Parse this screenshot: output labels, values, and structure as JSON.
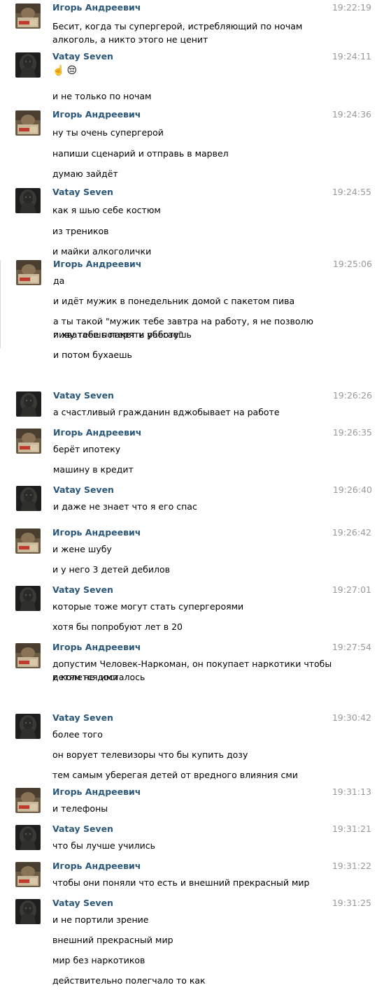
{
  "authors": {
    "igor": "Игорь Андреевич",
    "vatay": "Vatay Seven"
  },
  "messages": [
    {
      "author": "Игорь Андреевич",
      "avatar": "igor",
      "time": "19:22:19",
      "lines": [
        "Бесит, когда ты супергерой, истребляющий по ночам алкоголь, а никто этого не ценит"
      ]
    },
    {
      "author": "Vatay Seven",
      "avatar": "vatay",
      "time": "19:24:11",
      "emoji": [
        "☝️",
        "😔"
      ],
      "lines": [
        "и не только по ночам"
      ]
    },
    {
      "author": "Игорь Андреевич",
      "avatar": "igor",
      "time": "19:24:36",
      "lines": [
        "ну ты очень супергерой",
        "напиши сценарий и отправь в марвел",
        "думаю зайдёт"
      ]
    },
    {
      "author": "Vatay Seven",
      "avatar": "vatay",
      "time": "19:24:55",
      "lines": [
        "как я шью себе костюм",
        "из треников",
        "и майки алкоголички"
      ]
    },
    {
      "author": "Игорь Андреевич",
      "avatar": "igor",
      "time": "19:25:06",
      "lines": [
        "да",
        "и идёт мужик в понедельник домой с пакетом пива",
        "а ты такой \"мужик тебе завтра на работу, я не позволю пиву тебе потерять работу\"",
        "и хватаешь пакет и убегаешь",
        "и потом бухаешь"
      ]
    },
    {
      "author": "Vatay Seven",
      "avatar": "vatay",
      "time": "19:26:26",
      "lines": [
        "а счастливый гражданин вджобывает на работе"
      ]
    },
    {
      "author": "Игорь Андреевич",
      "avatar": "igor",
      "time": "19:26:35",
      "lines": [
        "берёт ипотеку",
        "машину в кредит"
      ]
    },
    {
      "author": "Vatay Seven",
      "avatar": "vatay",
      "time": "19:26:40",
      "lines": [
        "и даже не знает что я его спас"
      ]
    },
    {
      "author": "Игорь Андреевич",
      "avatar": "igor",
      "time": "19:26:42",
      "lines": [
        "и жене шубу",
        "и у него 3 детей дебилов"
      ]
    },
    {
      "author": "Vatay Seven",
      "avatar": "vatay",
      "time": "19:27:01",
      "lines": [
        "которые тоже могут стать супергероями",
        "хотя бы попробуют лет в 20"
      ]
    },
    {
      "author": "Игорь Андреевич",
      "avatar": "igor",
      "time": "19:27:54",
      "lines": [
        "допустим Человек-Наркоман, он покупает наркотики чтобы детям не досталось",
        "и колется ими"
      ]
    },
    {
      "author": "Vatay Seven",
      "avatar": "vatay",
      "time": "19:30:42",
      "lines": [
        "более того",
        "он ворует телевизоры что бы купить дозу",
        "тем самым уберегая детей от вредного влияния сми"
      ]
    },
    {
      "author": "Игорь Андреевич",
      "avatar": "igor",
      "time": "19:31:13",
      "lines": [
        "и телефоны"
      ]
    },
    {
      "author": "Vatay Seven",
      "avatar": "vatay",
      "time": "19:31:21",
      "lines": [
        "что бы лучше учились"
      ]
    },
    {
      "author": "Игорь Андреевич",
      "avatar": "igor",
      "time": "19:31:22",
      "lines": [
        "чтобы они поняли что есть и внешний прекрасный мир"
      ]
    },
    {
      "author": "Vatay Seven",
      "avatar": "vatay",
      "time": "19:31:25",
      "lines": [
        "и не портили зрение",
        "внешний прекрасный мир",
        "мир без наркотиков",
        "действительно полегчало то как"
      ]
    }
  ]
}
